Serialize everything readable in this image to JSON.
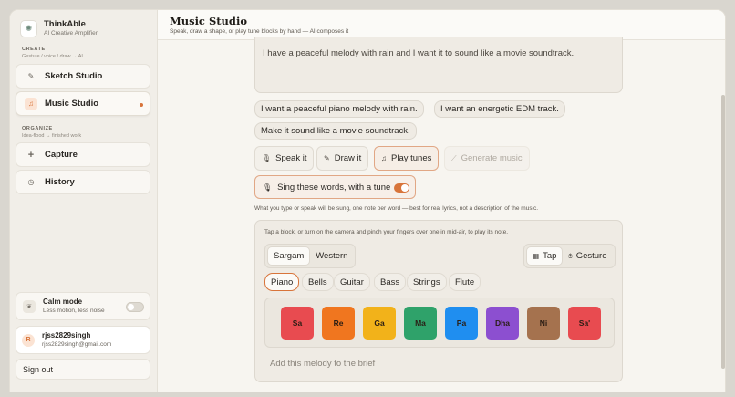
{
  "brand": {
    "name": "ThinkAble",
    "tagline": "AI Creative Amplifier"
  },
  "sidebar": {
    "create_title": "CREATE",
    "create_sub": "Gesture / voice / draw → AI",
    "organize_title": "ORGANIZE",
    "organize_sub": "Idea-flood → finished work",
    "items": [
      {
        "label": "Sketch Studio",
        "icon": "pencil-icon"
      },
      {
        "label": "Music Studio",
        "icon": "music-note-icon",
        "active": true
      },
      {
        "label": "Capture",
        "icon": "plus-icon"
      },
      {
        "label": "History",
        "icon": "clock-icon"
      }
    ],
    "calm": {
      "title": "Calm mode",
      "subtitle": "Less motion, less noise",
      "enabled": false
    },
    "user": {
      "initial": "R",
      "name": "rjss2829singh",
      "email": "rjss2829singh@gmail.com"
    },
    "signout": "Sign out"
  },
  "header": {
    "title": "Music Studio",
    "subtitle": "Speak, draw a shape, or play tune blocks by hand — AI composes it"
  },
  "brief": {
    "text": "I have a peaceful melody with rain and I want it to sound like a movie soundtrack."
  },
  "suggestions": [
    "I want a peaceful piano melody with rain.",
    "I want an energetic EDM track.",
    "Make it sound like a movie soundtrack."
  ],
  "actions": {
    "speak": "Speak it",
    "draw": "Draw it",
    "play": "Play tunes",
    "generate": "Generate music"
  },
  "sing": {
    "label": "Sing these words, with a tune",
    "enabled": true
  },
  "hint": "What you type or speak will be sung, one note per word — best for real lyrics, not a description of the music.",
  "pad": {
    "hint": "Tap a block, or turn on the camera and pinch your fingers over one in mid-air, to play its note.",
    "scales": [
      "Sargam",
      "Western"
    ],
    "modes": [
      "Tap",
      "Gesture"
    ],
    "instruments": [
      "Piano",
      "Bells",
      "Guitar",
      "Bass",
      "Strings",
      "Flute"
    ],
    "selected_instrument": "Piano",
    "notes": [
      {
        "label": "Sa",
        "color": "#e84b50"
      },
      {
        "label": "Re",
        "color": "#f0761f"
      },
      {
        "label": "Ga",
        "color": "#f2b21a"
      },
      {
        "label": "Ma",
        "color": "#2fa26a"
      },
      {
        "label": "Pa",
        "color": "#1f8ef0"
      },
      {
        "label": "Dha",
        "color": "#8c4fd0"
      },
      {
        "label": "Ni",
        "color": "#a5724e"
      },
      {
        "label": "Sa'",
        "color": "#e84b50"
      }
    ],
    "add_to_brief": "Add this melody to the brief"
  }
}
